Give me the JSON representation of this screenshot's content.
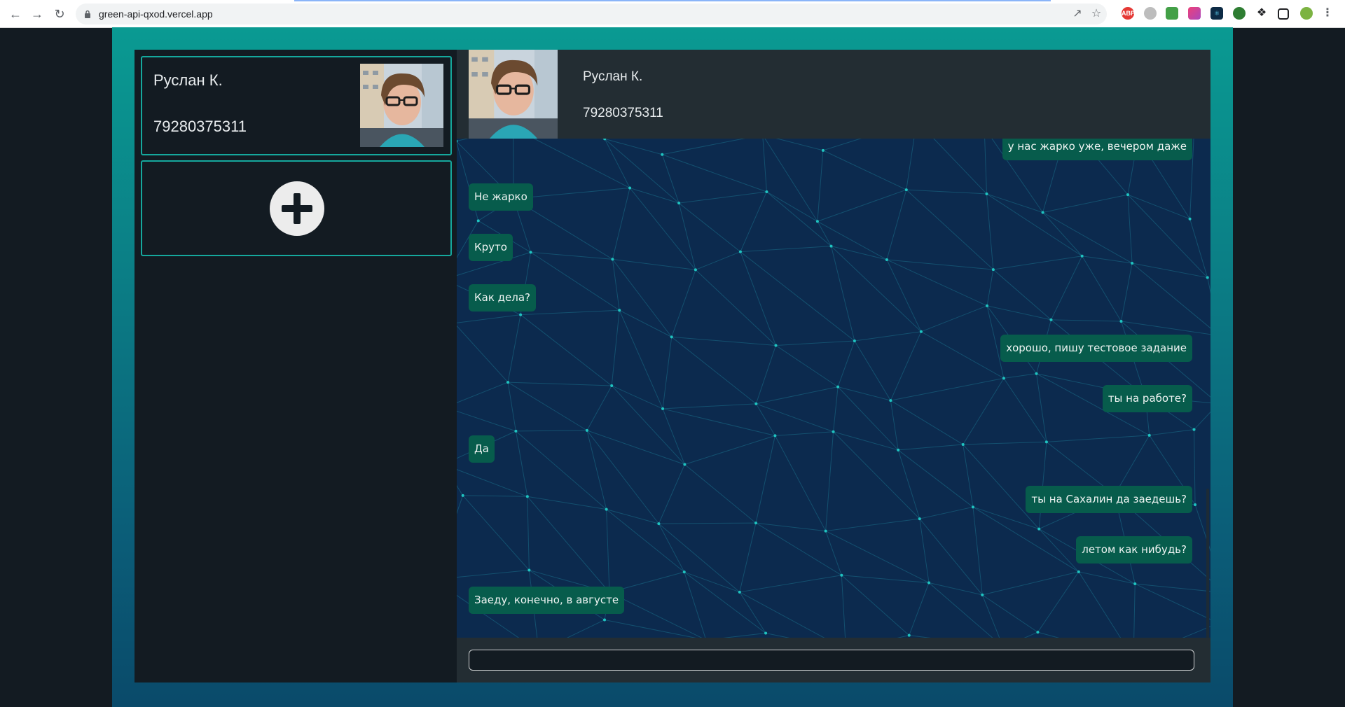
{
  "browser": {
    "url": "green-api-qxod.vercel.app",
    "nav": {
      "back_icon": "arrow-left-icon",
      "forward_icon": "arrow-right-icon",
      "reload_icon": "reload-icon"
    },
    "extensions": [
      {
        "name": "abp-icon",
        "label": "ABP",
        "color": "#e53935"
      },
      {
        "name": "globe-icon",
        "label": "",
        "color": "#9e9e9e"
      },
      {
        "name": "home-icon",
        "label": "",
        "color": "#43a047"
      },
      {
        "name": "palette-icon",
        "label": "",
        "color": "#ec407a"
      },
      {
        "name": "react-icon",
        "label": "",
        "color": "#0d2b45"
      },
      {
        "name": "refresh-ext-icon",
        "label": "",
        "color": "#2e7d32"
      },
      {
        "name": "puzzle-icon",
        "label": "",
        "color": "#5f6368"
      },
      {
        "name": "sidepanel-icon",
        "label": "",
        "color": "#202124"
      },
      {
        "name": "profile-icon",
        "label": "",
        "color": "#7cb342"
      },
      {
        "name": "menu-icon",
        "label": "",
        "color": "#5f6368"
      }
    ]
  },
  "sidebar": {
    "contacts": [
      {
        "name": "Руслан К.",
        "phone": "79280375311"
      }
    ],
    "add_contact_icon": "plus-circle-icon"
  },
  "chat": {
    "header": {
      "name": "Руслан К.",
      "phone": "79280375311"
    },
    "messages": [
      {
        "direction": "out",
        "text": "у нас жарко уже, вечером даже"
      },
      {
        "direction": "in",
        "text": "Не жарко"
      },
      {
        "direction": "in",
        "text": "Круто"
      },
      {
        "direction": "in",
        "text": "Как дела?"
      },
      {
        "direction": "out",
        "text": "хорошо, пишу тестовое задание"
      },
      {
        "direction": "out",
        "text": "ты на работе?"
      },
      {
        "direction": "in",
        "text": "Да"
      },
      {
        "direction": "out",
        "text": "ты на Сахалин да заедешь?"
      },
      {
        "direction": "out",
        "text": "летом как нибудь?"
      },
      {
        "direction": "in",
        "text": "Заеду, конечно, в августе"
      }
    ],
    "input": {
      "value": "",
      "placeholder": ""
    }
  },
  "colors": {
    "accent": "#15a89d",
    "bubble": "#075c4c",
    "chat_bg": "#0c2a4e",
    "panel": "#232d33",
    "sidebar": "#131b22"
  }
}
